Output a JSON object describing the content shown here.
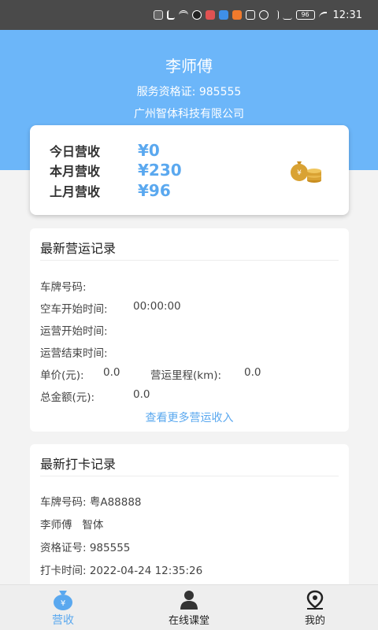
{
  "status_bar": {
    "time": "12:31",
    "battery": "96"
  },
  "profile": {
    "name": "李师傅",
    "cert": "服务资格证: 985555",
    "company": "广州智体科技有限公司"
  },
  "revenue": {
    "today_label": "今日营收",
    "today_value": "¥0",
    "month_label": "本月营收",
    "month_value": "¥230",
    "last_month_label": "上月营收",
    "last_month_value": "¥96"
  },
  "operation_record": {
    "title": "最新营运记录",
    "plate_label": "车牌号码:",
    "empty_start_label": "空车开始时间:",
    "empty_start_value": "00:00:00",
    "op_start_label": "运营开始时间:",
    "op_end_label": "运营结束时间:",
    "unit_price_label": "单价(元):",
    "unit_price_value": "0.0",
    "mileage_label": "营运里程(km):",
    "mileage_value": "0.0",
    "total_label": "总金额(元):",
    "total_value": "0.0",
    "more_link": "查看更多营运收入"
  },
  "checkin_record": {
    "title": "最新打卡记录",
    "plate": "车牌号码: 粤A88888",
    "driver": "李师傅   智体",
    "cert": "资格证号: 985555",
    "time": "打卡时间: 2022-04-24 12:35:26"
  },
  "tabs": [
    {
      "label": "营收",
      "icon": "money-bag-icon",
      "active": true
    },
    {
      "label": "在线课堂",
      "icon": "classroom-icon",
      "active": false
    },
    {
      "label": "我的",
      "icon": "location-pin-icon",
      "active": false
    }
  ],
  "colors": {
    "accent": "#5aa8ef",
    "header_bg": "#6cb6f9",
    "gold": "#d9a233"
  }
}
